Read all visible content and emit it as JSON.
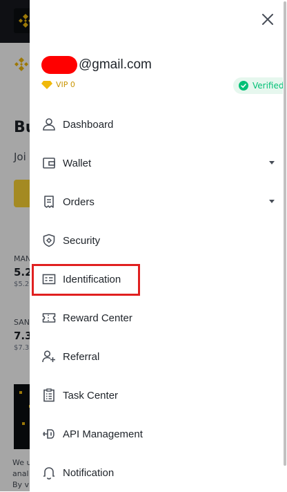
{
  "background": {
    "heading_partial": "Bu",
    "subtext_partial": "Joi",
    "ticker1": {
      "symbol": "MAN",
      "price": "5.2",
      "usd": "$5.2"
    },
    "ticker2": {
      "symbol": "SAN",
      "price": "7.3",
      "usd": "$7.3"
    },
    "footer_lines": [
      "We u",
      "anal",
      "By v"
    ]
  },
  "drawer": {
    "email_suffix": "@gmail.com",
    "vip_label": "VIP 0",
    "verified_label": "Verified",
    "menu": [
      {
        "label": "Dashboard",
        "icon": "user-icon",
        "has_caret": false
      },
      {
        "label": "Wallet",
        "icon": "wallet-icon",
        "has_caret": true
      },
      {
        "label": "Orders",
        "icon": "receipt-icon",
        "has_caret": true
      },
      {
        "label": "Security",
        "icon": "shield-icon",
        "has_caret": false
      },
      {
        "label": "Identification",
        "icon": "id-card-icon",
        "has_caret": false,
        "highlighted": true
      },
      {
        "label": "Reward Center",
        "icon": "ticket-icon",
        "has_caret": false
      },
      {
        "label": "Referral",
        "icon": "add-user-icon",
        "has_caret": false
      },
      {
        "label": "Task Center",
        "icon": "task-list-icon",
        "has_caret": false
      },
      {
        "label": "API Management",
        "icon": "plug-icon",
        "has_caret": false
      },
      {
        "label": "Notification",
        "icon": "bell-icon",
        "has_caret": false
      }
    ]
  },
  "colors": {
    "brand_yellow": "#f0b90b",
    "verified_green": "#02c076",
    "highlight_red": "#e02020"
  }
}
